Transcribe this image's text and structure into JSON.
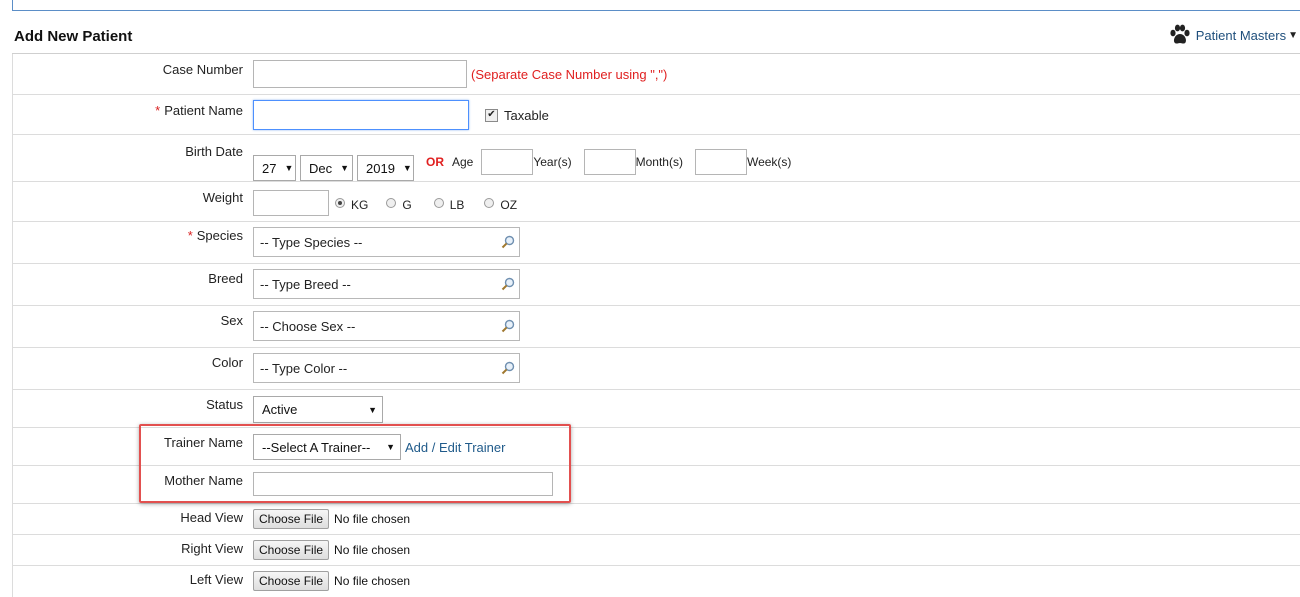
{
  "page": {
    "title": "Add New Patient"
  },
  "masters": {
    "label": "Patient Masters",
    "icon": "paw-icon"
  },
  "form": {
    "case_number": {
      "label": "Case Number",
      "value": "",
      "hint": "(Separate Case Number using \",\")"
    },
    "patient_name": {
      "required_mark": "*",
      "label": "Patient Name",
      "value": "",
      "taxable_label": "Taxable",
      "taxable_checked": true
    },
    "birth_date": {
      "label": "Birth Date",
      "day": "27",
      "month": "Dec",
      "year": "2019",
      "or_label": "OR",
      "age_label": "Age",
      "years_label": "Year(s)",
      "months_label": "Month(s)",
      "weeks_label": "Week(s)"
    },
    "weight": {
      "label": "Weight",
      "value": "",
      "units": [
        "KG",
        "G",
        "LB",
        "OZ"
      ],
      "selected_unit": "KG"
    },
    "species": {
      "required_mark": "*",
      "label": "Species",
      "placeholder": "-- Type Species --"
    },
    "breed": {
      "label": "Breed",
      "placeholder": "-- Type Breed --"
    },
    "sex": {
      "label": "Sex",
      "placeholder": "-- Choose Sex --"
    },
    "color": {
      "label": "Color",
      "placeholder": "-- Type Color --"
    },
    "status": {
      "label": "Status",
      "value": "Active"
    },
    "trainer": {
      "label": "Trainer Name",
      "value": "--Select A Trainer--",
      "link": "Add / Edit Trainer"
    },
    "mother": {
      "label": "Mother Name",
      "value": ""
    },
    "files": [
      {
        "label": "Head View",
        "button": "Choose File",
        "status": "No file chosen"
      },
      {
        "label": "Right View",
        "button": "Choose File",
        "status": "No file chosen"
      },
      {
        "label": "Left View",
        "button": "Choose File",
        "status": "No file chosen"
      }
    ]
  },
  "colors": {
    "accent_link": "#1f5a8a",
    "required": "#d92020",
    "highlight": "#e2504f"
  }
}
